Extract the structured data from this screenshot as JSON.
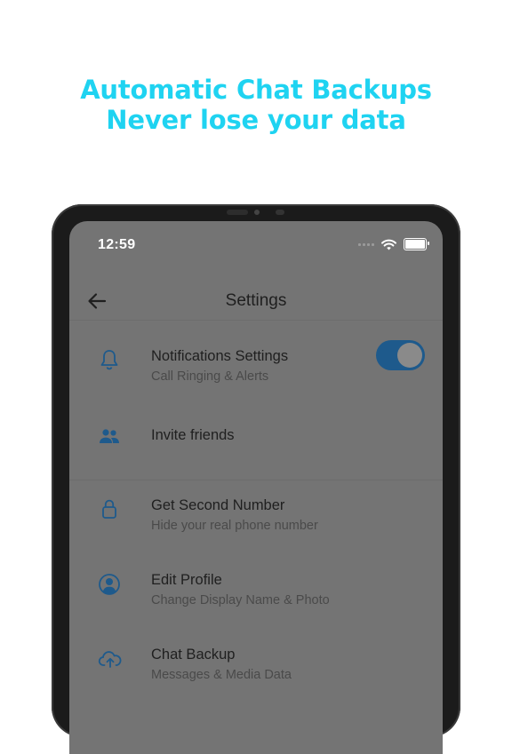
{
  "headline": {
    "line1": "Automatic Chat Backups",
    "line2": "Never lose your data"
  },
  "status_bar": {
    "time": "12:59"
  },
  "app_bar": {
    "title": "Settings"
  },
  "settings": {
    "items": [
      {
        "title": "Notifications Settings",
        "subtitle": "Call Ringing & Alerts",
        "icon": "bell-icon",
        "toggle_on": true
      },
      {
        "title": "Invite friends",
        "icon": "people-icon"
      },
      {
        "title": "Get Second Number",
        "subtitle": "Hide your real phone number",
        "icon": "lock-icon"
      },
      {
        "title": "Edit Profile",
        "subtitle": "Change Display Name & Photo",
        "icon": "profile-icon"
      },
      {
        "title": "Chat Backup",
        "subtitle": "Messages & Media Data",
        "icon": "cloud-upload-icon"
      }
    ]
  },
  "colors": {
    "headline": "#1fd3f1",
    "accent": "#1e5a8c",
    "icon": "#1e5a8c"
  }
}
